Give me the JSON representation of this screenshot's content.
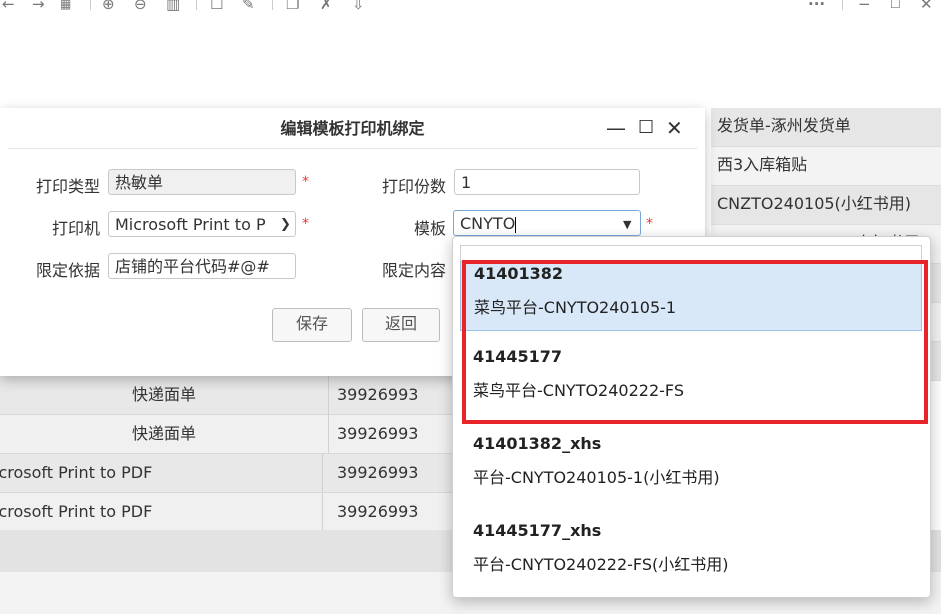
{
  "toolbar": {
    "icons": [
      "back-arrow-icon",
      "forward-arrow-icon",
      "grid-icon",
      "zoom-in-icon",
      "zoom-out-icon",
      "chart-icon",
      "square-icon",
      "edit-icon",
      "copy-icon",
      "cross-icon",
      "download-icon",
      "more-icon",
      "minimize-icon",
      "maximize-icon",
      "close-icon"
    ],
    "more_label": "···"
  },
  "background_list": [
    "发货单-涿州发货单",
    "西3入库箱贴",
    "CNZTO240105(小红书用)",
    "CNYTO240105-1(小红书用)"
  ],
  "background_table": {
    "rows": [
      {
        "type": "快递面单",
        "id": "39926993"
      },
      {
        "type": "快递面单",
        "id": "39926993"
      },
      {
        "type": "icrosoft Print to PDF",
        "id": "39926993"
      },
      {
        "type": "icrosoft Print to PDF",
        "id": "39926993"
      }
    ]
  },
  "dialog": {
    "title": "编辑模板打印机绑定",
    "window_controls": {
      "minimize": "—",
      "maximize": "☐",
      "close": "✕"
    },
    "fields": {
      "print_type": {
        "label": "打印类型",
        "value": "热敏单"
      },
      "copies": {
        "label": "打印份数",
        "value": "1"
      },
      "printer": {
        "label": "打印机",
        "value": "Microsoft Print to P"
      },
      "template": {
        "label": "模板",
        "value": "CNYTO"
      },
      "basis": {
        "label": "限定依据",
        "value": "店铺的平台代码#@#"
      },
      "content": {
        "label": "限定内容",
        "value": ""
      }
    },
    "required_mark": "*",
    "buttons": {
      "save": "保存",
      "back": "返回"
    }
  },
  "dropdown": {
    "items": [
      {
        "code": "41401382",
        "name": "菜鸟平台-CNYTO240105-1",
        "selected": true
      },
      {
        "code": "41445177",
        "name": "菜鸟平台-CNYTO240222-FS",
        "selected": false
      },
      {
        "code": "41401382_xhs",
        "name": "平台-CNYTO240105-1(小红书用)",
        "selected": false
      },
      {
        "code": "41445177_xhs",
        "name": "平台-CNYTO240222-FS(小红书用)",
        "selected": false
      }
    ]
  },
  "colors": {
    "highlight": "#e8232a",
    "selected_bg": "#d8e8f8",
    "required": "#e53935"
  }
}
